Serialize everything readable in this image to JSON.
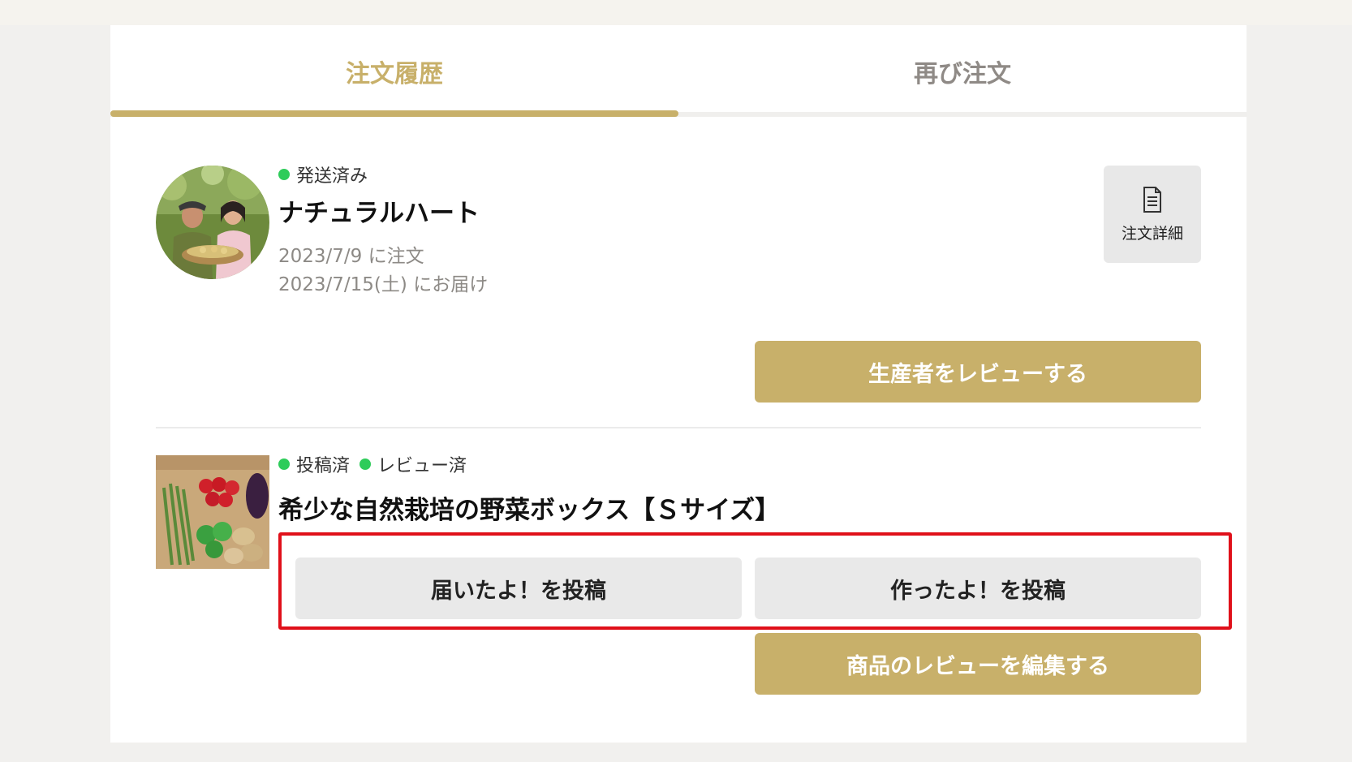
{
  "colors": {
    "accent": "#c8b06a",
    "green": "#2ecc5a",
    "highlight": "#e0101a"
  },
  "tabs": [
    {
      "label": "注文履歴",
      "active": true
    },
    {
      "label": "再び注文",
      "active": false
    }
  ],
  "orders": [
    {
      "statuses": [
        "発送済み"
      ],
      "title": "ナチュラルハート",
      "ordered": "2023/7/9 に注文",
      "delivery": "2023/7/15(土) にお届け",
      "detail_label": "注文詳細",
      "detail_icon": "document-icon",
      "review_button": "生産者をレビューする"
    },
    {
      "statuses": [
        "投稿済",
        "レビュー済"
      ],
      "title": "希少な自然栽培の野菜ボックス【Ｓサイズ】",
      "arrived_button": "届いたよ！を投稿",
      "made_button": "作ったよ！を投稿",
      "edit_review_button": "商品のレビューを編集する"
    }
  ]
}
